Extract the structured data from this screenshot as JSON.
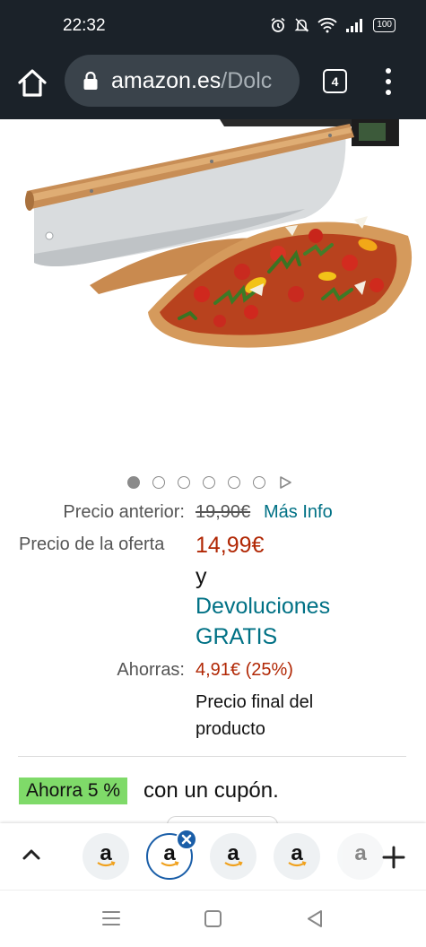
{
  "status": {
    "time": "22:32",
    "battery": "100"
  },
  "browser": {
    "url_domain": "amazon.es",
    "url_path": "/Dolc",
    "tab_count": "4"
  },
  "carousel": {
    "image_count": 6,
    "active_index": 0
  },
  "pricing": {
    "previous_label": "Precio anterior:",
    "previous_value": "19,90€",
    "more_info": "Más Info",
    "offer_label": "Precio de la oferta",
    "offer_value": "14,99€",
    "conjunction": "y",
    "returns_line1": "Devoluciones",
    "returns_line2": "GRATIS",
    "savings_label": "Ahorras:",
    "savings_value": "4,91€ (25%)",
    "final_line1": "Precio final del",
    "final_line2": "producto"
  },
  "coupon": {
    "badge": "Ahorra 5 %",
    "text": "con un cupón."
  },
  "tab_strip": {
    "favicon_letter": "a",
    "active_tab_index": 1
  },
  "colors": {
    "link": "#007185",
    "price_red": "#b12704",
    "coupon_green": "#7fda69",
    "chrome_dark": "#1b2229"
  }
}
